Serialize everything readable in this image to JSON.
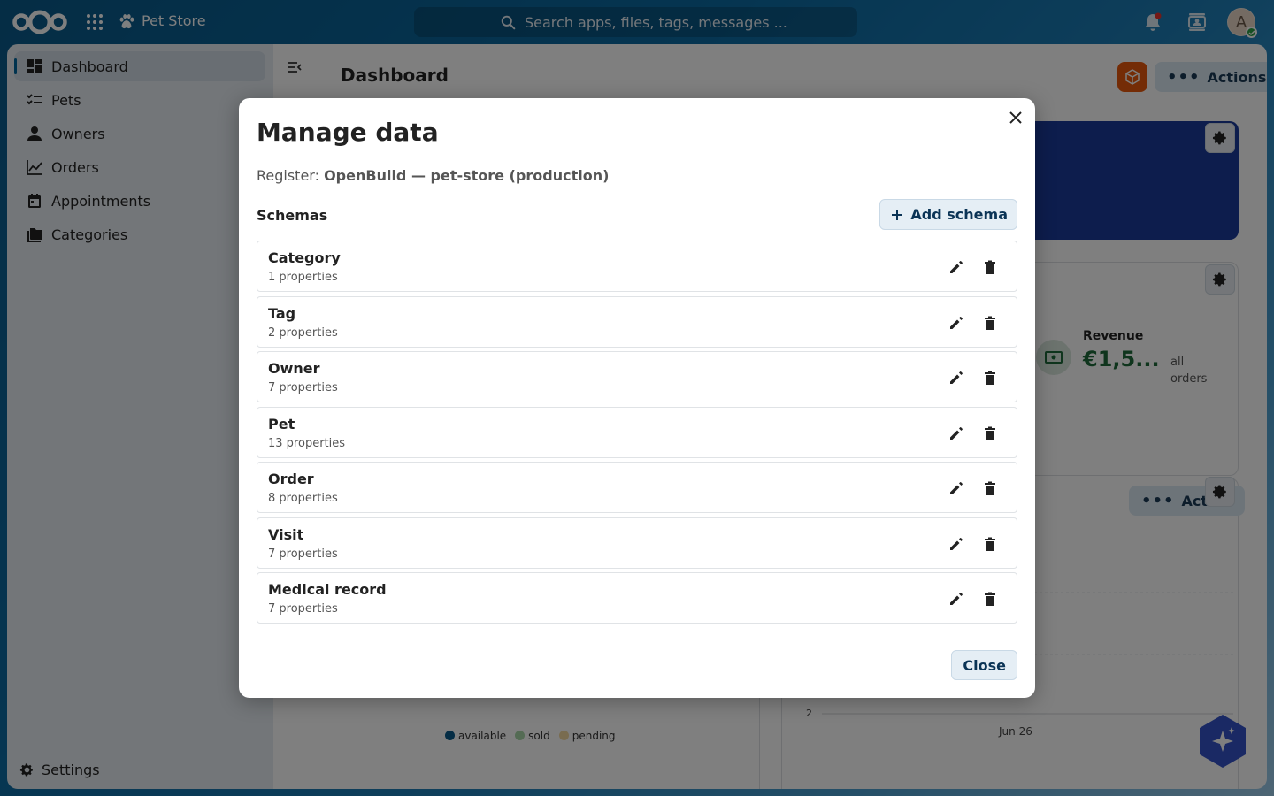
{
  "header": {
    "app_name": "Pet Store",
    "search_placeholder": "Search apps, files, tags, messages ...",
    "avatar_letter": "A"
  },
  "sidebar": {
    "items": [
      {
        "label": "Dashboard",
        "icon": "dashboard-icon",
        "active": true
      },
      {
        "label": "Pets",
        "icon": "checklist-icon"
      },
      {
        "label": "Owners",
        "icon": "person-icon"
      },
      {
        "label": "Orders",
        "icon": "chart-line-icon"
      },
      {
        "label": "Appointments",
        "icon": "calendar-icon"
      },
      {
        "label": "Categories",
        "icon": "folders-icon"
      }
    ],
    "settings_label": "Settings"
  },
  "main": {
    "title": "Dashboard",
    "actions_label": "Actions",
    "revenue": {
      "label": "Revenue",
      "value": "€1,5...",
      "sub": "all orders"
    },
    "actions2_label": "Action",
    "pie_legend": [
      {
        "label": "available",
        "color": "#0a5a8a"
      },
      {
        "label": "sold",
        "color": "#a9d7a8"
      },
      {
        "label": "pending",
        "color": "#f2d9a0"
      }
    ],
    "axis_tick": "2",
    "axis_date": "Jun 26"
  },
  "modal": {
    "title": "Manage data",
    "register_prefix": "Register:",
    "register_name": "OpenBuild — pet-store (production)",
    "schemas_heading": "Schemas",
    "add_schema_label": "Add schema",
    "schemas": [
      {
        "name": "Category",
        "props": "1 properties"
      },
      {
        "name": "Tag",
        "props": "2 properties"
      },
      {
        "name": "Owner",
        "props": "7 properties"
      },
      {
        "name": "Pet",
        "props": "13 properties"
      },
      {
        "name": "Order",
        "props": "8 properties"
      },
      {
        "name": "Visit",
        "props": "7 properties"
      },
      {
        "name": "Medical record",
        "props": "7 properties"
      }
    ],
    "close_label": "Close"
  },
  "colors": {
    "accent": "#00679e",
    "orange_brand": "#e9590c",
    "hero_card": "#1b3a9a",
    "revenue_green": "#1f6b3a"
  }
}
